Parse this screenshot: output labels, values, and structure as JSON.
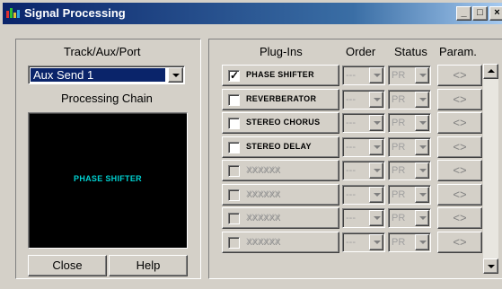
{
  "window": {
    "title": "Signal Processing",
    "controls": {
      "minimize": "_",
      "maximize": "□",
      "close": "×"
    }
  },
  "left_panel": {
    "track_label": "Track/Aux/Port",
    "track_value": "Aux Send 1",
    "chain_label": "Processing Chain",
    "chain_items": [
      "PHASE SHIFTER"
    ],
    "close_label": "Close",
    "help_label": "Help"
  },
  "headers": {
    "plugins": "Plug-Ins",
    "order": "Order",
    "status": "Status",
    "param": "Param."
  },
  "rows": [
    {
      "name": "PHASE SHIFTER",
      "checked": true,
      "enabled": true,
      "order": "---",
      "status": "PR",
      "param": "<>"
    },
    {
      "name": "REVERBERATOR",
      "checked": false,
      "enabled": true,
      "order": "---",
      "status": "PR",
      "param": "<>"
    },
    {
      "name": "STEREO CHORUS",
      "checked": false,
      "enabled": true,
      "order": "---",
      "status": "PR",
      "param": "<>"
    },
    {
      "name": "STEREO DELAY",
      "checked": false,
      "enabled": true,
      "order": "---",
      "status": "PR",
      "param": "<>"
    },
    {
      "name": "XXXXXX",
      "checked": false,
      "enabled": false,
      "order": "---",
      "status": "PR",
      "param": "<>"
    },
    {
      "name": "XXXXXX",
      "checked": false,
      "enabled": false,
      "order": "---",
      "status": "PR",
      "param": "<>"
    },
    {
      "name": "XXXXXX",
      "checked": false,
      "enabled": false,
      "order": "---",
      "status": "PR",
      "param": "<>"
    },
    {
      "name": "XXXXXX",
      "checked": false,
      "enabled": false,
      "order": "---",
      "status": "PR",
      "param": "<>"
    }
  ],
  "colors": {
    "titlebar_start": "#0a246a",
    "titlebar_end": "#a6caf0",
    "selection": "#0a246a",
    "chain_bg": "#000000",
    "chain_text": "#00d0d0",
    "face": "#d4d0c8"
  },
  "icons": {
    "app": "signal-processing-app-icon",
    "dropdown": "chevron-down-icon",
    "checkmark": "checkmark-icon"
  }
}
